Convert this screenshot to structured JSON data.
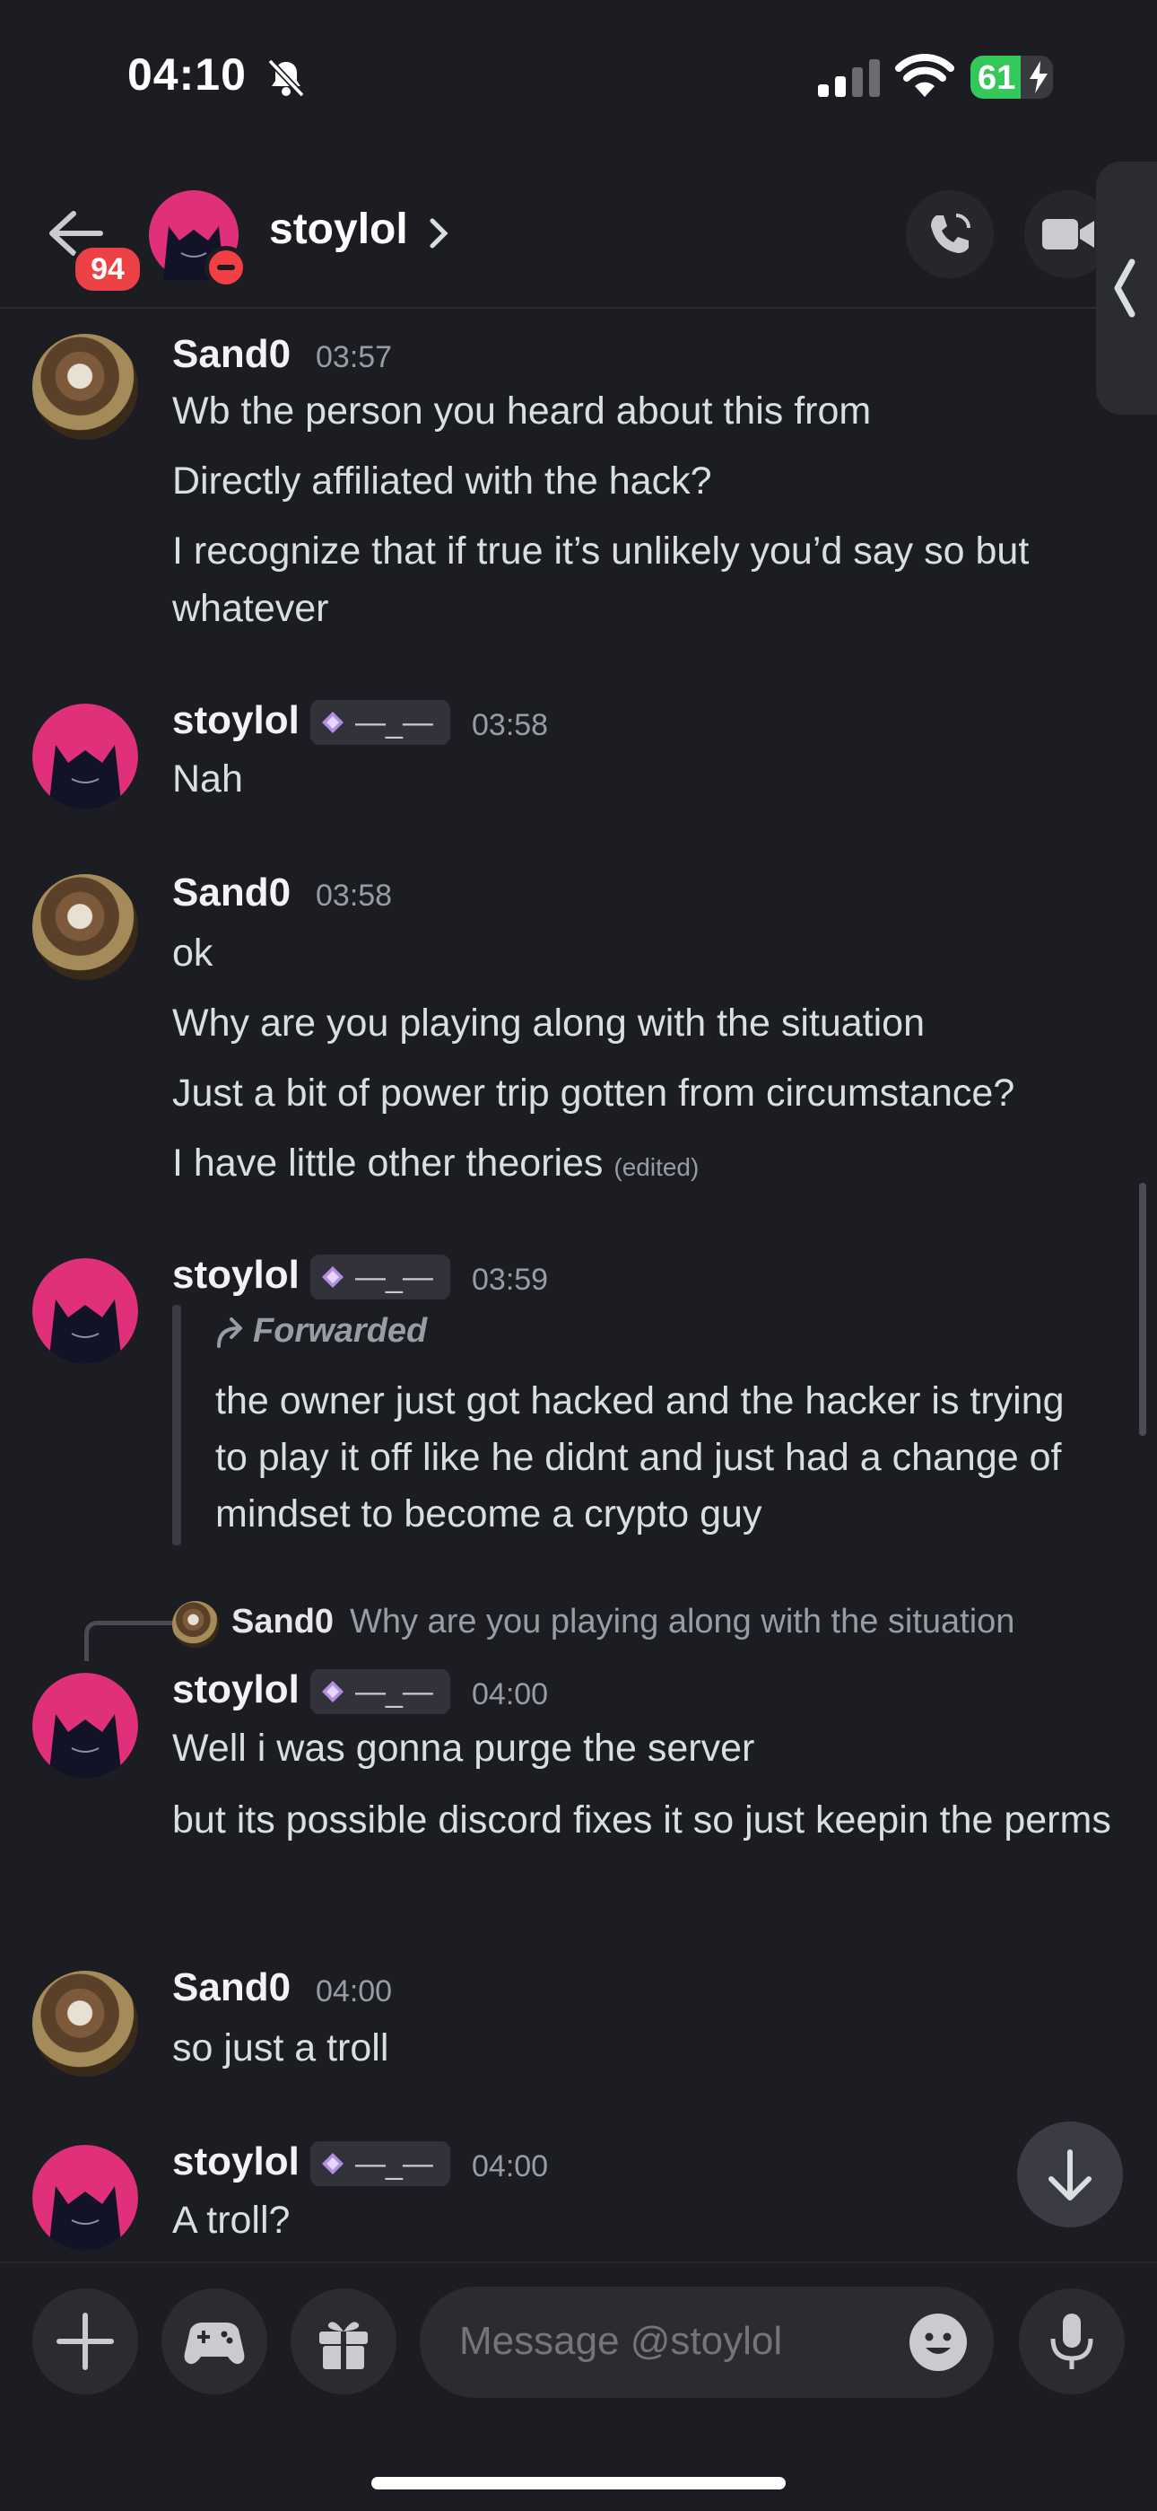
{
  "status_bar": {
    "time": "04:10",
    "battery": "61",
    "battery_level": 0.61,
    "icons": [
      "bell-slash-icon",
      "signal-icon",
      "wifi-icon",
      "battery-charging-icon"
    ]
  },
  "header": {
    "unread_badge": "94",
    "username": "stoylol",
    "status": "do-not-disturb",
    "icons": [
      "back-arrow-icon",
      "chevron-right-icon",
      "phone-icon",
      "video-icon",
      "chevron-left-icon"
    ]
  },
  "tag_text": "—_—",
  "messages": [
    {
      "author": "Sand0",
      "time": "03:57",
      "lines": [
        "Wb the person you heard about this from",
        "Directly affiliated with the hack?",
        "I recognize that if true it’s unlikely you’d say so but whatever"
      ]
    },
    {
      "author": "stoylol",
      "time": "03:58",
      "lines": [
        "Nah"
      ]
    },
    {
      "author": "Sand0",
      "time": "03:58",
      "lines": [
        "ok",
        "Why are you playing along with the situation",
        "Just a bit of power trip gotten from circumstance?",
        "I have little other theories"
      ],
      "edited": "(edited)"
    },
    {
      "author": "stoylol",
      "time": "03:59",
      "forwarded_label": "Forwarded",
      "forwarded_text": "the owner just got hacked and the hacker is trying to play it off like he didnt and just had a change of mindset to become a crypto guy"
    },
    {
      "author": "stoylol",
      "time": "04:00",
      "reply_to": {
        "author": "Sand0",
        "text": "Why are you playing along with the situation"
      },
      "lines": [
        "Well i was gonna purge the server",
        "but its possible discord fixes it so just keepin the perms"
      ]
    },
    {
      "author": "Sand0",
      "time": "04:00",
      "lines": [
        "so just a troll"
      ]
    },
    {
      "author": "stoylol",
      "time": "04:00",
      "lines": [
        "A troll?"
      ]
    }
  ],
  "composer": {
    "placeholder": "Message @stoylol",
    "icons": [
      "plus-icon",
      "gamepad-icon",
      "gift-icon",
      "emoji-icon",
      "microphone-icon"
    ]
  },
  "colors": {
    "background": "#1c1d22",
    "badge_red": "#ed4245",
    "battery_green": "#34c759",
    "avatar_pink": "#e0307a"
  }
}
